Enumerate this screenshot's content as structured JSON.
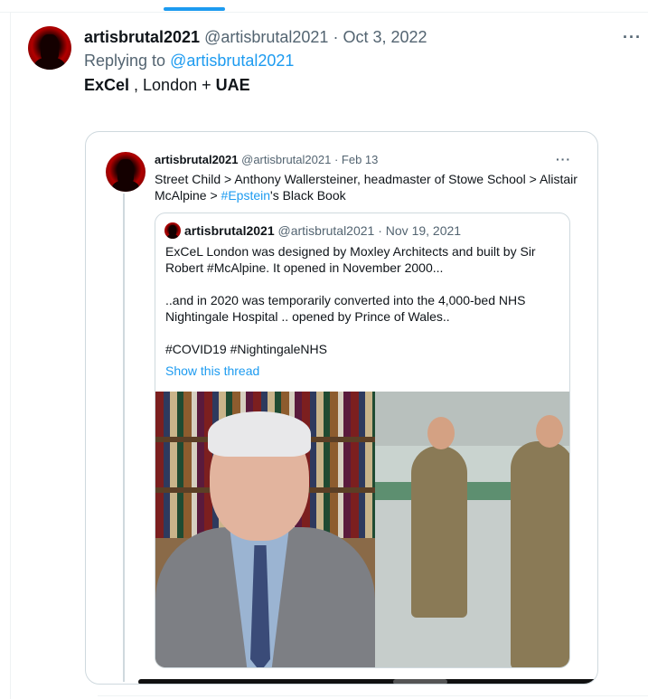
{
  "main_tweet": {
    "author_name": "artisbrutal2021",
    "author_handle": "@artisbrutal2021",
    "separator": "·",
    "date": "Oct 3, 2022",
    "replying_prefix": "Replying to ",
    "replying_handle": "@artisbrutal2021",
    "text_bold_1": "ExCel",
    "text_mid": " , London + ",
    "text_bold_2": "UAE",
    "more_label": "···"
  },
  "quoted_tweet": {
    "author_name": "artisbrutal2021",
    "author_handle": "@artisbrutal2021",
    "separator": "·",
    "date": "Feb 13",
    "text_before": "Street Child > Anthony Wallersteiner, headmaster of Stowe School > Alistair McAlpine > ",
    "hashtag": "#Epstein",
    "text_after": "'s Black Book",
    "more_label": "···"
  },
  "inner_quote": {
    "author_name": "artisbrutal2021",
    "author_handle": "@artisbrutal2021",
    "separator": "·",
    "date": "Nov 19, 2021",
    "text": "ExCeL London was designed by Moxley Architects and built by Sir Robert #McAlpine. It opened in November 2000...\n\n..and in 2020 was  temporarily converted into the 4,000-bed NHS Nightingale Hospital .. opened by Prince of Wales..\n\n#COVID19 #NightingaleNHS",
    "show_thread": "Show this thread"
  },
  "colors": {
    "accent": "#1d9bf0",
    "text_primary": "#0f1419",
    "text_secondary": "#536471",
    "border": "#cfd9de"
  }
}
